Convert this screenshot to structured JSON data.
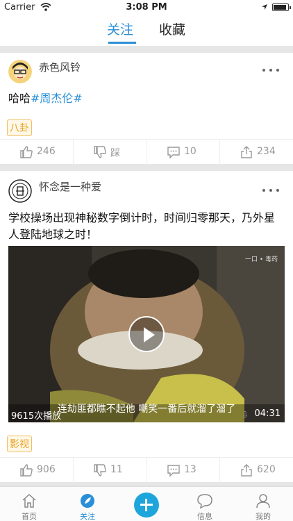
{
  "status": {
    "carrier": "Carrier",
    "time": "3:08 PM"
  },
  "topnav": {
    "tabs": [
      {
        "label": "关注",
        "active": true
      },
      {
        "label": "收藏",
        "active": false
      }
    ],
    "accent": "#2a8fd6"
  },
  "posts": [
    {
      "user": "赤色风铃",
      "text": "哈哈",
      "hashtag": "#周杰伦#",
      "tag": "八卦",
      "actions": {
        "like": "246",
        "dislike": "踩",
        "comment": "10",
        "share": "234"
      }
    },
    {
      "user": "怀念是一种爱",
      "text": "学校操场出现神秘数字倒计时，时间归零那天，乃外星人登陆地球之时！",
      "video": {
        "subtitle": "连劫匪都瞧不起他 嘲笑一番后就溜了溜了",
        "plays": "9615次播放",
        "duration": "04:31",
        "watermark": "一口 • 毒药"
      },
      "tag": "影视",
      "actions": {
        "like": "906",
        "dislike": "11",
        "comment": "13",
        "share": "620"
      }
    }
  ],
  "tabbar": {
    "items": [
      {
        "label": "首页",
        "icon": "home-icon"
      },
      {
        "label": "关注",
        "icon": "compass-icon",
        "active": true
      },
      {
        "label": "",
        "icon": "plus-icon"
      },
      {
        "label": "信息",
        "icon": "chat-bubble-icon"
      },
      {
        "label": "我的",
        "icon": "person-icon"
      }
    ]
  }
}
